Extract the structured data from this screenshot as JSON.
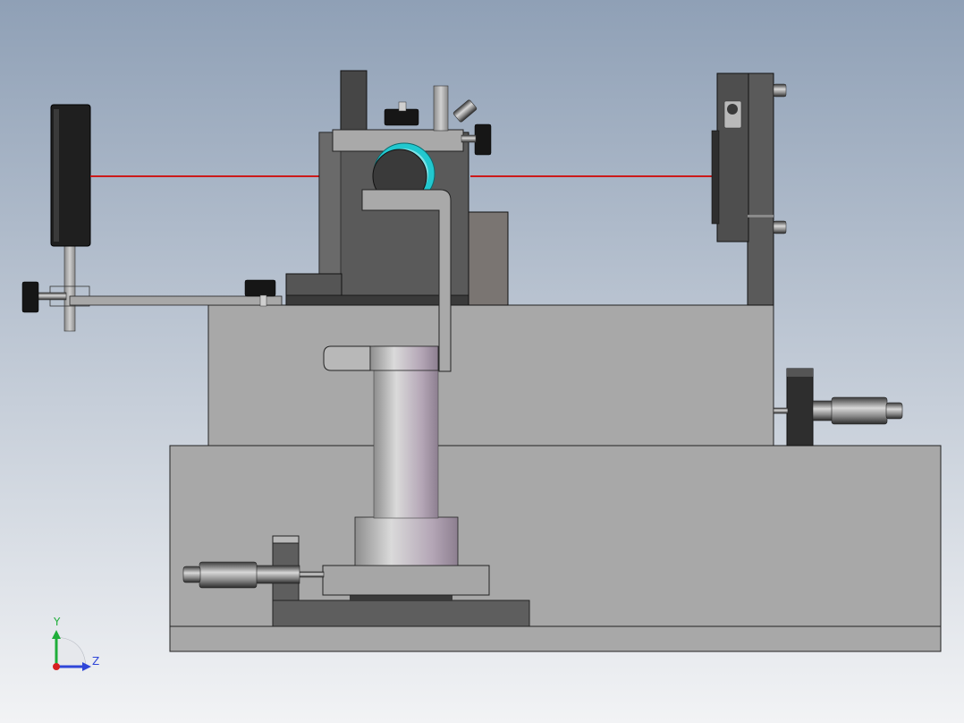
{
  "viewport": {
    "background_top": "#8fa0b6",
    "background_bottom": "#f2f3f5"
  },
  "triad": {
    "y_label": "Y",
    "z_label": "Z",
    "y_color": "#1fae3a",
    "z_color": "#2f46d8",
    "x_color": "#d62020"
  },
  "model": {
    "beam_color": "#cc1a1a",
    "lens_color": "#22c8cf"
  }
}
